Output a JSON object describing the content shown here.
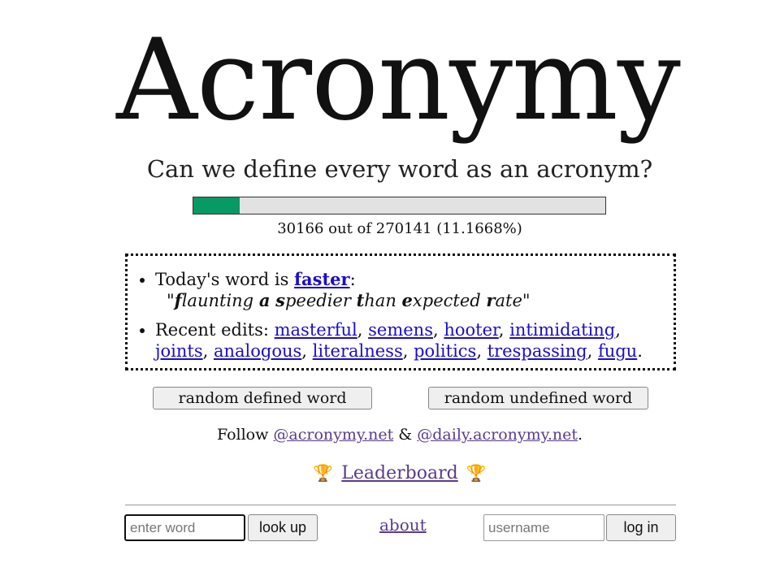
{
  "header": {
    "logo_text": "Acronymy",
    "tagline": "Can we define every word as an acronym?"
  },
  "progress": {
    "defined": "30166",
    "total": "270141",
    "percent_label": "30166 out of 270141 (11.1668%)",
    "fraction": 0.111668,
    "fill_color": "#089a64"
  },
  "today": {
    "prefix": "Today's word is ",
    "word": "faster",
    "suffix": ":",
    "definition": [
      {
        "initial": "f",
        "rest": "launting"
      },
      {
        "initial": "a",
        "rest": ""
      },
      {
        "initial": "s",
        "rest": "peedier"
      },
      {
        "initial": "t",
        "rest": "han"
      },
      {
        "initial": "e",
        "rest": "xpected"
      },
      {
        "initial": "r",
        "rest": "ate"
      }
    ]
  },
  "recent": {
    "prefix": "Recent edits: ",
    "words": [
      "masterful",
      "semens",
      "hooter",
      "intimidating",
      "joints",
      "analogous",
      "literalness",
      "politics",
      "trespassing",
      "fugu"
    ]
  },
  "buttons": {
    "random_defined": "random defined word",
    "random_undefined": "random undefined word"
  },
  "follow": {
    "prefix": "Follow ",
    "handle1": "@acronymy.net",
    "amp": " & ",
    "handle2": "@daily.acronymy.net",
    "suffix": "."
  },
  "leaderboard": {
    "label": "Leaderboard",
    "icon": "trophy-icon"
  },
  "footer": {
    "word_placeholder": "enter word",
    "lookup_label": "look up",
    "about_label": "about",
    "username_placeholder": "username",
    "login_label": "log in"
  }
}
